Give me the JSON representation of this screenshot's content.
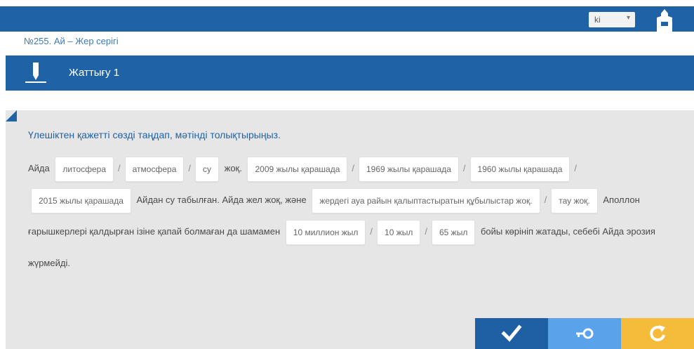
{
  "header": {
    "lang_value": "ki",
    "lang_arrow": "▾",
    "home_icon": "home-icon"
  },
  "breadcrumb": "№255. Ай – Жер серігі",
  "title": "Жаттығу 1",
  "instruction": "Үлешіктен қажетті сөзді таңдап, мәтінді толықтырыңыз.",
  "exercise": {
    "t1": "Айда",
    "o1": [
      "литосфера",
      "атмосфера",
      "су"
    ],
    "t2": "жоқ.",
    "o2": [
      "2009 жылы қарашада",
      "1969 жылы қарашада",
      "1960 жылы қарашада",
      "2015 жылы қарашада"
    ],
    "t3": "Айдан су табылған. Айда жел жоқ, және",
    "o3": [
      "жердегі ауа райын қалыптастыратын құбылыстар жоқ.",
      "тау жоқ."
    ],
    "t4": "Аполлон ғарышкерлері қалдырған",
    "t5": "ізіне қапай болмаған да шамамен",
    "o4": [
      "10 миллион жыл",
      "10 жыл",
      "65 жыл"
    ],
    "t6": "бойы көрініп жатады,",
    "t7": "себебі Айда эрозия жүрмейді."
  },
  "separator": "/",
  "actions": {
    "check_icon": "check-icon",
    "key_icon": "key-icon",
    "reset_icon": "reset-icon"
  },
  "colors": {
    "primary": "#2062a6",
    "check": "#1f5fa3",
    "key": "#5aa3ea",
    "reset": "#f5bb3a",
    "panel": "#e6e6e6"
  }
}
